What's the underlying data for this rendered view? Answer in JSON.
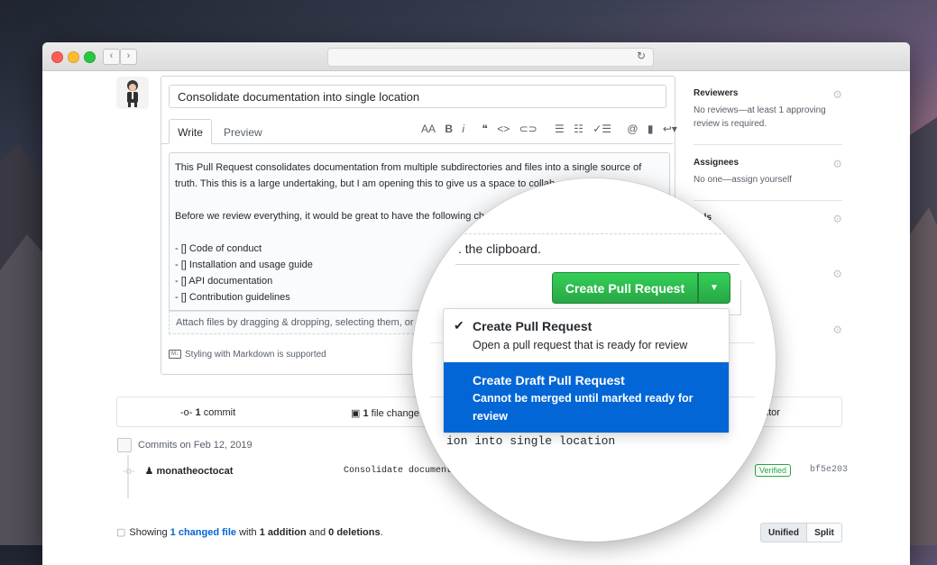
{
  "browser": {
    "reload_icon": "reload-icon",
    "new_tab": "+"
  },
  "pr": {
    "title": "Consolidate documentation into single location",
    "tabs": {
      "write": "Write",
      "preview": "Preview"
    },
    "toolbar": {
      "heading": "AA",
      "bold": "B",
      "italic": "i",
      "quote": "❝",
      "code": "<>",
      "link": "⊂⊃",
      "ul": "☰",
      "ol": "☷",
      "task": "✓☰",
      "mention": "@",
      "ref": "▮",
      "reply": "↩▾"
    },
    "body_lines": [
      "This Pull Request consolidates documentation from multiple subdirectories and files into a single source of",
      "truth.  This this is a large undertaking, but I am opening this to give us a space to collab",
      "",
      "Before we review everything, it would be great to have the following ch",
      "",
      "- [] Code of conduct",
      "- [] Installation and usage guide",
      "- [] API documentation",
      "- [] Contribution guidelines"
    ],
    "attach_text": "Attach files by dragging & dropping, selecting them, or p",
    "markdown_hint": "Styling with Markdown is supported"
  },
  "sidebar": {
    "reviewers": {
      "title": "Reviewers",
      "text": "No reviews—at least 1 approving review is required."
    },
    "assignees": {
      "title": "Assignees",
      "text": "No one—assign yourself"
    },
    "labels": {
      "title": "bels"
    }
  },
  "stats": {
    "commits_count": "1",
    "commits_label": "commit",
    "files_count": "1",
    "files_label": "file change",
    "contributors_label": "utor"
  },
  "commits": {
    "header": "Commits on Feb 12, 2019",
    "row": {
      "author": "monatheoctocat",
      "message": "Consolidate documentat",
      "verified": "Verified",
      "sha": "bf5e203"
    }
  },
  "diff": {
    "showing_prefix": "Showing ",
    "changed_link": "1 changed file",
    "with": " with ",
    "additions": "1 addition",
    "and": " and ",
    "deletions": "0 deletions",
    "suffix": ".",
    "view_unified": "Unified",
    "view_split": "Split"
  },
  "zoom": {
    "clipboard_text": ". the clipboard.",
    "create_button": "Create Pull Request",
    "menu": [
      {
        "title": "Create Pull Request",
        "desc": "Open a pull request that is ready for review",
        "checked": true
      },
      {
        "title": "Create Draft Pull Request",
        "desc_line1": "Cannot be merged until marked ready for",
        "desc_line2": "review",
        "selected": true
      }
    ],
    "code_text": "ion into single location"
  },
  "colors": {
    "accent_green": "#28a745",
    "menu_selected": "#0366d6",
    "link": "#0366d6"
  }
}
